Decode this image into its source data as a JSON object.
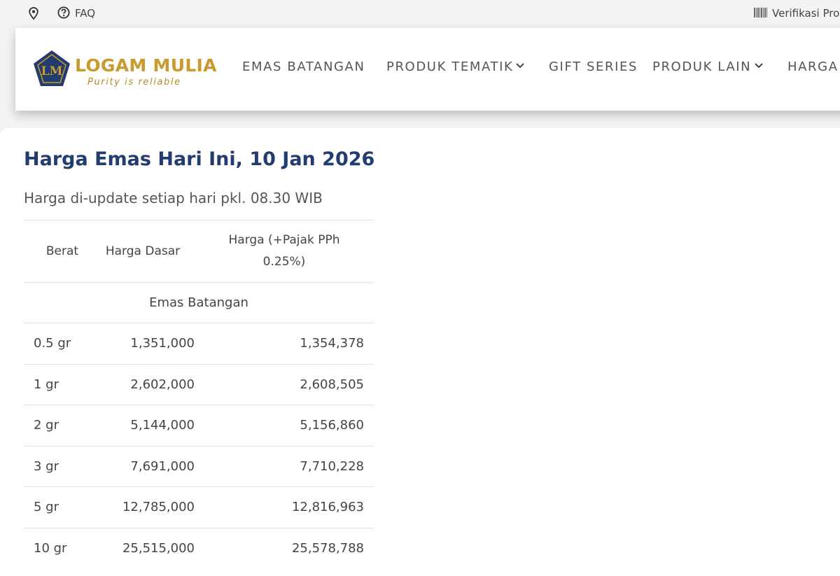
{
  "topbar": {
    "location_icon": "map-pin-icon",
    "faq_icon": "question-circle-icon",
    "faq_label": "FAQ",
    "barcode_icon": "barcode-icon",
    "verify_label": "Verifikasi Produk"
  },
  "header": {
    "logo": {
      "mark_text": "LM",
      "brand": "LOGAM MULIA",
      "tagline": "Purity is reliable"
    },
    "nav": [
      {
        "label": "EMAS BATANGAN",
        "has_dropdown": false
      },
      {
        "label": "PRODUK TEMATIK",
        "has_dropdown": true
      },
      {
        "label": "GIFT SERIES",
        "has_dropdown": false
      },
      {
        "label": "PRODUK LAIN",
        "has_dropdown": true
      },
      {
        "label": "HARGA",
        "has_dropdown": false
      }
    ]
  },
  "main": {
    "title": "Harga Emas Hari Ini, 10 Jan 2026",
    "subtitle": "Harga di-update setiap hari pkl. 08.30 WIB",
    "table": {
      "headers": [
        "Berat",
        "Harga Dasar",
        "Harga (+Pajak PPh 0.25%)"
      ],
      "group": "Emas Batangan",
      "rows": [
        {
          "berat": "0.5 gr",
          "dasar": "1,351,000",
          "pajak": "1,354,378"
        },
        {
          "berat": "1 gr",
          "dasar": "2,602,000",
          "pajak": "2,608,505"
        },
        {
          "berat": "2 gr",
          "dasar": "5,144,000",
          "pajak": "5,156,860"
        },
        {
          "berat": "3 gr",
          "dasar": "7,691,000",
          "pajak": "7,710,228"
        },
        {
          "berat": "5 gr",
          "dasar": "12,785,000",
          "pajak": "12,816,963"
        },
        {
          "berat": "10 gr",
          "dasar": "25,515,000",
          "pajak": "25,578,788"
        }
      ]
    }
  },
  "colors": {
    "title": "#233c70",
    "brand_gold": "#c99a2e",
    "logo_navy": "#233c70",
    "background": "#f3f3f3"
  }
}
